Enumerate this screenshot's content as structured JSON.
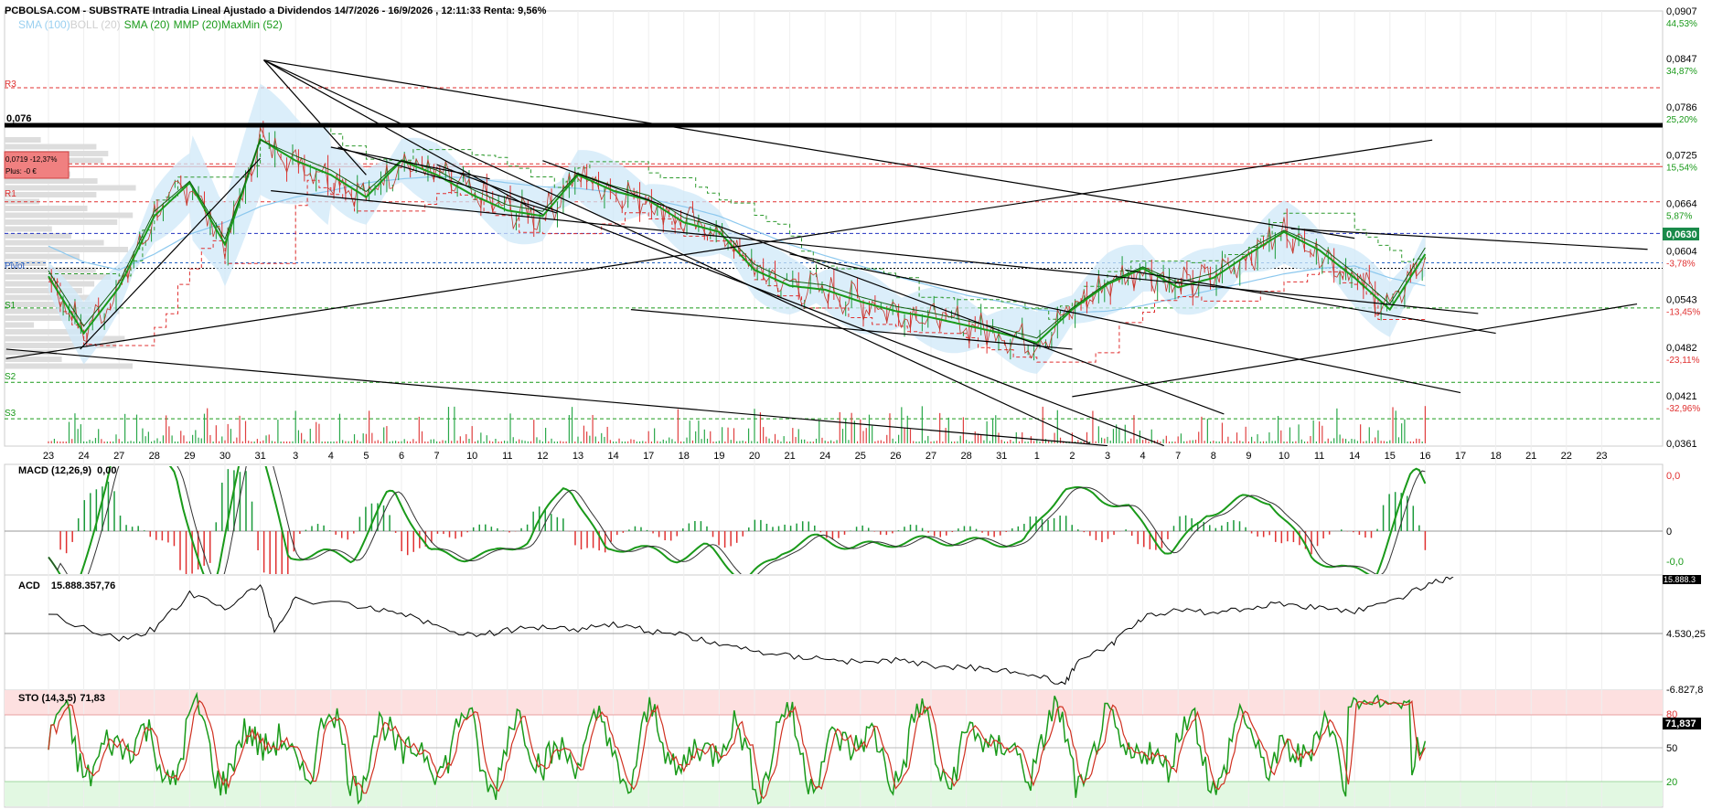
{
  "header": {
    "title": "PCBOLSA.COM - SUBSTRATE Intradia Lineal Ajustado a Dividendos 14/7/2026 - 16/9/2026 , 12:11:33 Renta: 9,56%",
    "legend": [
      {
        "label": "SMA (100)",
        "color": "#9ad0f0"
      },
      {
        "label": "BOLL (20)",
        "color": "#d8d8d8"
      },
      {
        "label": "SMA (20)",
        "color": "#1a9a1a"
      },
      {
        "label": "MMP (20)",
        "color": "#1a9a1a"
      },
      {
        "label": "MaxMin (52)",
        "color": "#1a9a1a"
      }
    ]
  },
  "colors": {
    "price": "#c0392b",
    "sma20": "#1a9a1a",
    "sma100": "#8cc8ee",
    "band": "#cfe8f8",
    "maxmin_up": "#2e9a2e",
    "maxmin_down": "#e03030",
    "trendline": "#000000",
    "up": "#1a9a3a",
    "down": "#e03030"
  },
  "price_box": {
    "line1": "0,0719 -12,37%",
    "line2": "Plus: -0 €"
  },
  "current_price_tag": "0,0630",
  "level_076": "0,076",
  "pivot_labels": {
    "r3": "R3",
    "r1": "R1",
    "pivot": "Pivot",
    "s1": "S1",
    "s2": "S2",
    "s3": "S3"
  },
  "x_ticks": [
    "23",
    "24",
    "27",
    "28",
    "29",
    "30",
    "31",
    "3",
    "4",
    "5",
    "6",
    "7",
    "10",
    "11",
    "12",
    "13",
    "14",
    "17",
    "18",
    "19",
    "20",
    "21",
    "24",
    "25",
    "26",
    "27",
    "28",
    "31",
    "1",
    "2",
    "3",
    "4",
    "7",
    "8",
    "9",
    "10",
    "11",
    "14",
    "15",
    "16",
    "17",
    "18",
    "21",
    "22",
    "23"
  ],
  "main_axis": [
    {
      "value": "0,0907",
      "pct": "44,53%"
    },
    {
      "value": "0,0847",
      "pct": "34,87%"
    },
    {
      "value": "0,0786",
      "pct": "25,20%"
    },
    {
      "value": "0,0725",
      "pct": "15,54%"
    },
    {
      "value": "0,0664",
      "pct": "5,87%"
    },
    {
      "value": "0,0604",
      "pct": "-3,78%"
    },
    {
      "value": "0,0543",
      "pct": "-13,45%"
    },
    {
      "value": "0,0482",
      "pct": "-23,11%"
    },
    {
      "value": "0,0421",
      "pct": "-32,96%"
    },
    {
      "value": "0,0361",
      "pct": ""
    }
  ],
  "macd": {
    "label": "MACD (12,26,9)",
    "value": "0,00",
    "axis_top": "0,0",
    "axis_mid": "0",
    "axis_bot": "-0,0"
  },
  "acd": {
    "label": "ACD",
    "value": "15.888.357,76",
    "axis_top": "15.888.3",
    "axis_mid": "4.530,25",
    "axis_bot": "-6.827,8"
  },
  "sto": {
    "label": "STO (14,3,5)",
    "value": "71,83",
    "axis_80": "80",
    "axis_50": "50",
    "axis_20": "20",
    "tag": "71,837"
  },
  "chart_data": {
    "type": "line",
    "title": "PCBOLSA.COM - SUBSTRATE Intradia Lineal Ajustado a Dividendos 14/7/2026 - 16/9/2026 , 12:11:33 Renta: 9,56%",
    "ylim": [
      0.0361,
      0.0907
    ],
    "x": [
      "23",
      "24",
      "27",
      "28",
      "29",
      "30",
      "31",
      "3",
      "4",
      "5",
      "6",
      "7",
      "10",
      "11",
      "12",
      "13",
      "14",
      "17",
      "18",
      "19",
      "20",
      "21",
      "24",
      "25",
      "26",
      "27",
      "28",
      "31",
      "1",
      "2",
      "3",
      "4",
      "7",
      "8",
      "9",
      "10",
      "11",
      "14",
      "15",
      "16"
    ],
    "series": [
      {
        "name": "SMA (20)",
        "values": [
          0.0572,
          0.05,
          0.0558,
          0.0648,
          0.069,
          0.0612,
          0.0745,
          0.0718,
          0.07,
          0.0672,
          0.0718,
          0.07,
          0.0675,
          0.0655,
          0.0648,
          0.07,
          0.068,
          0.0668,
          0.064,
          0.0628,
          0.058,
          0.056,
          0.0555,
          0.054,
          0.0528,
          0.052,
          0.051,
          0.05,
          0.0488,
          0.053,
          0.0562,
          0.0582,
          0.0558,
          0.057,
          0.06,
          0.0628,
          0.0605,
          0.057,
          0.053,
          0.06
        ]
      },
      {
        "name": "MMP (20)",
        "values": [
          0.0575,
          0.0505,
          0.056,
          0.065,
          0.0688,
          0.0615,
          0.074,
          0.072,
          0.0702,
          0.0675,
          0.0715,
          0.0702,
          0.0678,
          0.0658,
          0.065,
          0.0698,
          0.0682,
          0.067,
          0.0642,
          0.063,
          0.0583,
          0.0562,
          0.0557,
          0.0542,
          0.053,
          0.0522,
          0.0512,
          0.0502,
          0.049,
          0.0528,
          0.056,
          0.058,
          0.056,
          0.0572,
          0.0602,
          0.0626,
          0.0607,
          0.0572,
          0.0533,
          0.0604
        ]
      },
      {
        "name": "SMA (100)",
        "values": [
          0.061,
          0.059,
          0.058,
          0.06,
          0.0625,
          0.064,
          0.066,
          0.0672,
          0.068,
          0.069,
          0.0695,
          0.0698,
          0.0696,
          0.069,
          0.0685,
          0.0683,
          0.0678,
          0.067,
          0.066,
          0.0648,
          0.063,
          0.0612,
          0.0598,
          0.0585,
          0.0572,
          0.056,
          0.0548,
          0.054,
          0.053,
          0.0526,
          0.0528,
          0.0535,
          0.0545,
          0.0555,
          0.0565,
          0.0575,
          0.0582,
          0.0585,
          0.057,
          0.056
        ]
      }
    ],
    "levels": [
      {
        "name": "R3",
        "value": 0.081
      },
      {
        "name": "0,076",
        "value": 0.076
      },
      {
        "name": "R2",
        "value": 0.0714
      },
      {
        "name": "R1",
        "value": 0.0666
      },
      {
        "name": "0,0630",
        "value": 0.0626
      },
      {
        "name": "Pivot",
        "value": 0.0582
      },
      {
        "name": "S1",
        "value": 0.0532
      },
      {
        "name": "S2",
        "value": 0.0438
      },
      {
        "name": "S3",
        "value": 0.0392
      }
    ],
    "current_price": 0.063
  }
}
